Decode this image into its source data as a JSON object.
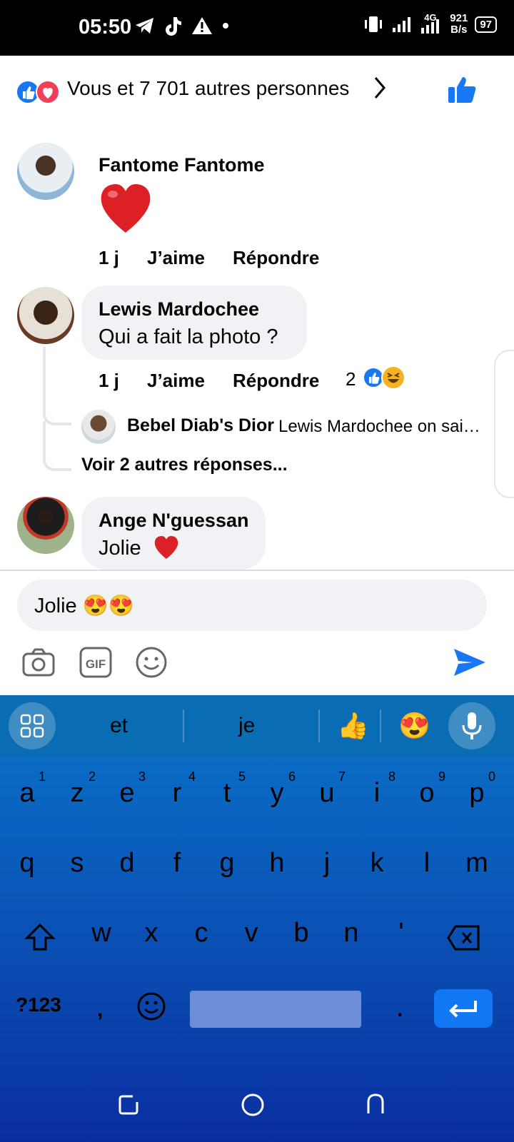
{
  "status_bar": {
    "time": "05:50",
    "net_speed_value": "921",
    "net_speed_unit": "B/s",
    "battery": "97",
    "network": "4G"
  },
  "reactions": {
    "summary": "Vous et 7 701 autres personnes"
  },
  "comments": [
    {
      "author": "Fantome Fantome",
      "time": "1 j",
      "like": "J’aime",
      "reply": "Répondre"
    },
    {
      "author": "Lewis Mardochee",
      "text": "Qui a fait la photo ?",
      "time": "1 j",
      "like": "J’aime",
      "reply": "Répondre",
      "reaction_count": "2",
      "reply_preview": {
        "author": "Bebel Diab's Dior",
        "text": "Lewis Mardochee on sai…"
      },
      "see_more": "Voir 2 autres réponses..."
    },
    {
      "author": "Ange N'guessan",
      "text": "Jolie"
    }
  ],
  "composer": {
    "value": "Jolie 😍😍"
  },
  "keyboard": {
    "suggestions": [
      "et",
      "je"
    ],
    "emoji_suggestions": [
      "👍",
      "😍"
    ],
    "row1": [
      {
        "ch": "a",
        "num": "1"
      },
      {
        "ch": "z",
        "num": "2"
      },
      {
        "ch": "e",
        "num": "3"
      },
      {
        "ch": "r",
        "num": "4"
      },
      {
        "ch": "t",
        "num": "5"
      },
      {
        "ch": "y",
        "num": "6"
      },
      {
        "ch": "u",
        "num": "7"
      },
      {
        "ch": "i",
        "num": "8"
      },
      {
        "ch": "o",
        "num": "9"
      },
      {
        "ch": "p",
        "num": "0"
      }
    ],
    "row2": [
      "q",
      "s",
      "d",
      "f",
      "g",
      "h",
      "j",
      "k",
      "l",
      "m"
    ],
    "row3": [
      "w",
      "x",
      "c",
      "v",
      "b",
      "n",
      "'"
    ],
    "symbols_label": "?123",
    "comma": ",",
    "period": "."
  },
  "colors": {
    "facebook_blue": "#1877f2",
    "love_red": "#f33e58",
    "keyboard_top": "#0a74c9",
    "keyboard_bottom": "#0a2ea0"
  }
}
